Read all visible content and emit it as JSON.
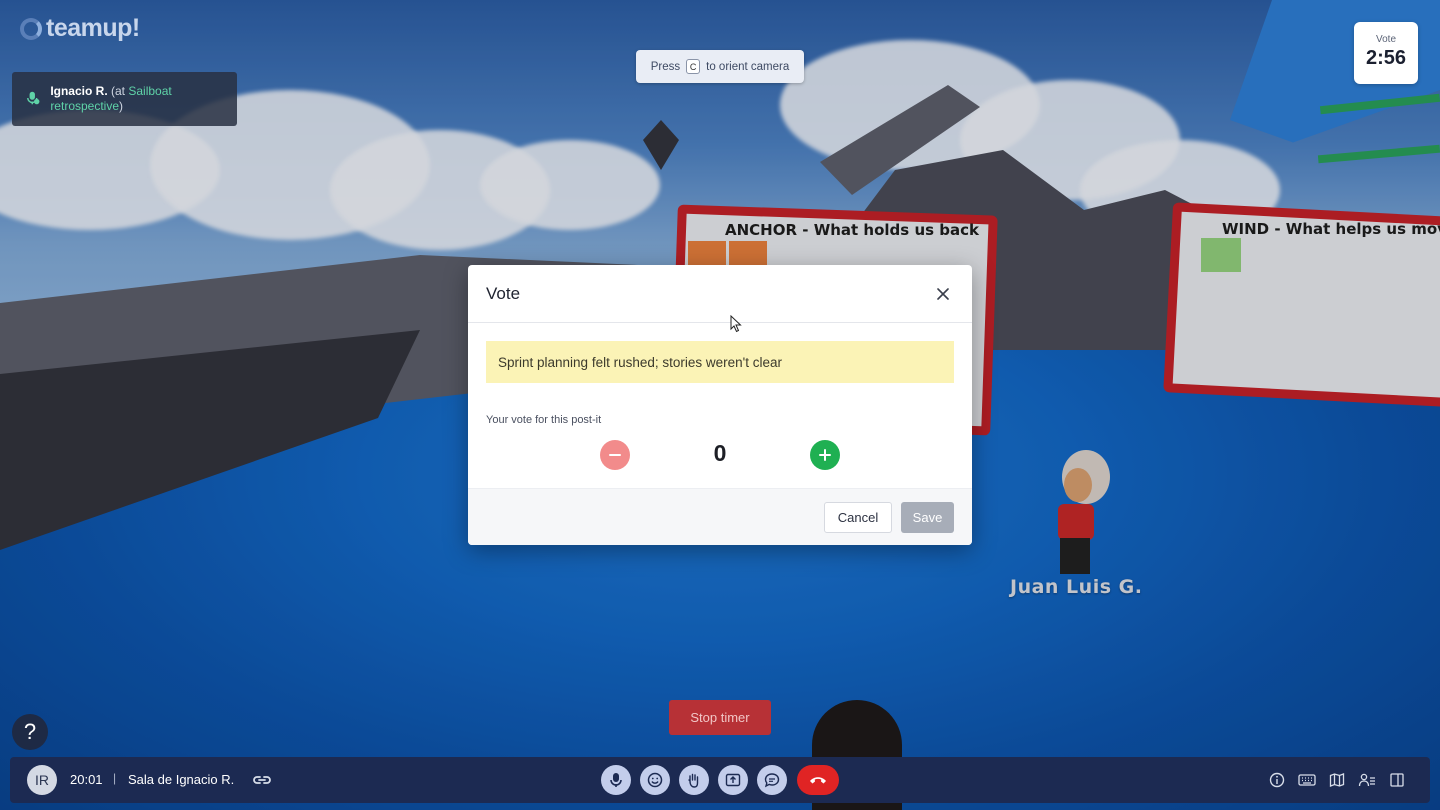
{
  "app": {
    "logo_text": "teamup!"
  },
  "user_card": {
    "name": "Ignacio R.",
    "at_prefix": "(at ",
    "location": "Sailboat retrospective",
    "at_suffix": ")"
  },
  "hint": {
    "prefix": "Press",
    "key": "C",
    "suffix": "to orient camera"
  },
  "vote_timer": {
    "label": "Vote",
    "time": "2:56"
  },
  "scene": {
    "board_anchor_title": "ANCHOR - What holds us back",
    "board_wind_title": "WIND - What helps us mov",
    "avatar_name": "Juan Luis G."
  },
  "modal": {
    "title": "Vote",
    "postit_text": "Sprint planning felt rushed; stories weren't clear",
    "vote_label": "Your vote for this post-it",
    "vote_count": "0",
    "cancel_label": "Cancel",
    "save_label": "Save"
  },
  "stop_timer_label": "Stop timer",
  "help_label": "?",
  "bottom_bar": {
    "avatar_initials": "IR",
    "time": "20:01",
    "separator": "|",
    "room": "Sala de Ignacio R."
  },
  "colors": {
    "hangup": "#e02424",
    "vote_plus": "#1fb052",
    "vote_minus": "#f28b8b",
    "postit": "#fbf3b6",
    "board_frame": "#c42228"
  }
}
